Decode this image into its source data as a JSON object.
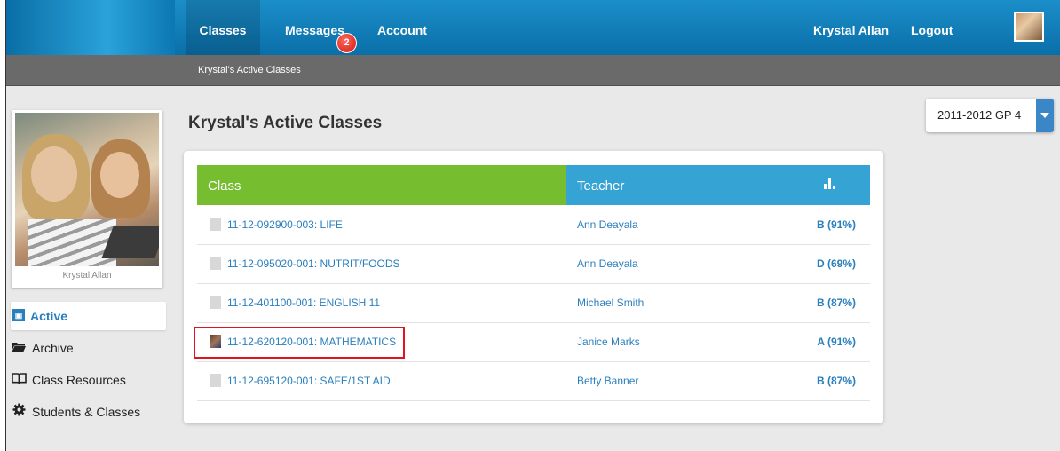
{
  "nav": {
    "tabs": [
      {
        "label": "Classes",
        "active": true
      },
      {
        "label": "Messages",
        "badge": "2"
      },
      {
        "label": "Account"
      }
    ],
    "user_name": "Krystal Allan",
    "logout_label": "Logout"
  },
  "breadcrumb": "Krystal's Active Classes",
  "sidebar": {
    "profile_name": "Krystal Allan",
    "items": [
      {
        "label": "Active",
        "icon": "active-classes-icon",
        "active": true
      },
      {
        "label": "Archive",
        "icon": "folder-icon"
      },
      {
        "label": "Class Resources",
        "icon": "book-icon"
      },
      {
        "label": "Students & Classes",
        "icon": "gear-icon"
      }
    ]
  },
  "main": {
    "title": "Krystal's Active Classes",
    "term": "2011-2012 GP 4",
    "table": {
      "headers": {
        "class": "Class",
        "teacher": "Teacher",
        "grade_icon": "bar-chart-icon"
      },
      "rows": [
        {
          "class": "11-12-092900-003: LIFE",
          "teacher": "Ann Deayala",
          "grade": "B (91%)"
        },
        {
          "class": "11-12-095020-001: NUTRIT/FOODS",
          "teacher": "Ann Deayala",
          "grade": "D (69%)"
        },
        {
          "class": "11-12-401100-001: ENGLISH 11",
          "teacher": "Michael Smith",
          "grade": "B (87%)"
        },
        {
          "class": "11-12-620120-001: MATHEMATICS",
          "teacher": "Janice Marks",
          "grade": "A (91%)",
          "highlighted": true
        },
        {
          "class": "11-12-695120-001: SAFE/1ST AID",
          "teacher": "Betty Banner",
          "grade": "B (87%)"
        }
      ]
    }
  },
  "colors": {
    "nav_blue": "#0a6fa8",
    "class_header_green": "#76bd2f",
    "teacher_header_blue": "#35a3d4",
    "link_blue": "#2a7fbd",
    "highlight_red": "#e0141f",
    "badge_red": "#d4150f"
  }
}
